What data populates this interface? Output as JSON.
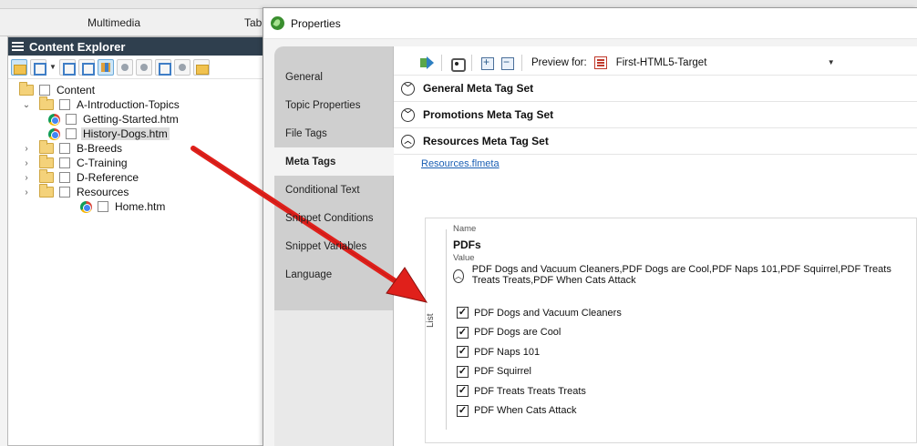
{
  "ribbon": {
    "tab_multimedia": "Multimedia",
    "tab_table": "Tabl"
  },
  "explorer": {
    "title": "Content Explorer",
    "tree": [
      {
        "label": "Content",
        "type": "folder",
        "level": 0
      },
      {
        "label": "A-Introduction-Topics",
        "type": "folder",
        "level": 1,
        "chevron": "⌄"
      },
      {
        "label": "Getting-Started.htm",
        "type": "file",
        "level": 2
      },
      {
        "label": "History-Dogs.htm",
        "type": "file",
        "level": 2,
        "selected": true
      },
      {
        "label": "B-Breeds",
        "type": "folder",
        "level": 1,
        "chevron": "›"
      },
      {
        "label": "C-Training",
        "type": "folder",
        "level": 1,
        "chevron": "›"
      },
      {
        "label": "D-Reference",
        "type": "folder",
        "level": 1,
        "chevron": "›"
      },
      {
        "label": "Resources",
        "type": "folder",
        "level": 1,
        "chevron": "›"
      },
      {
        "label": "Home.htm",
        "type": "file",
        "level": 1
      }
    ]
  },
  "props": {
    "title": "Properties",
    "tabs": [
      "General",
      "Topic Properties",
      "File Tags",
      "Meta Tags",
      "Conditional Text",
      "Snippet Conditions",
      "Snippet Variables",
      "Language"
    ],
    "active_tab": "Meta Tags",
    "toolbar": {
      "preview_label": "Preview for:",
      "target": "First-HTML5-Target"
    },
    "sections": [
      {
        "label": "General Meta Tag Set",
        "expanded": false
      },
      {
        "label": "Promotions Meta Tag Set",
        "expanded": false
      },
      {
        "label": "Resources Meta Tag Set",
        "expanded": true
      }
    ],
    "file_link": "Resources.flmeta",
    "meta": {
      "name_label": "Name",
      "name": "PDFs",
      "value_label": "Value",
      "summary": "PDF Dogs and Vacuum Cleaners,PDF Dogs are Cool,PDF Naps 101,PDF Squirrel,PDF Treats Treats Treats,PDF When Cats Attack",
      "list_label": "List",
      "items": [
        {
          "label": "PDF Dogs and Vacuum Cleaners",
          "checked": true
        },
        {
          "label": "PDF Dogs are Cool",
          "checked": true
        },
        {
          "label": "PDF Naps 101",
          "checked": true
        },
        {
          "label": "PDF Squirrel",
          "checked": true
        },
        {
          "label": "PDF Treats Treats Treats",
          "checked": true
        },
        {
          "label": "PDF When Cats Attack",
          "checked": true
        }
      ]
    }
  },
  "colors": {
    "explorer_header": "#2f3f4e",
    "link": "#1a5fb4",
    "arrow": "#e0201b"
  }
}
